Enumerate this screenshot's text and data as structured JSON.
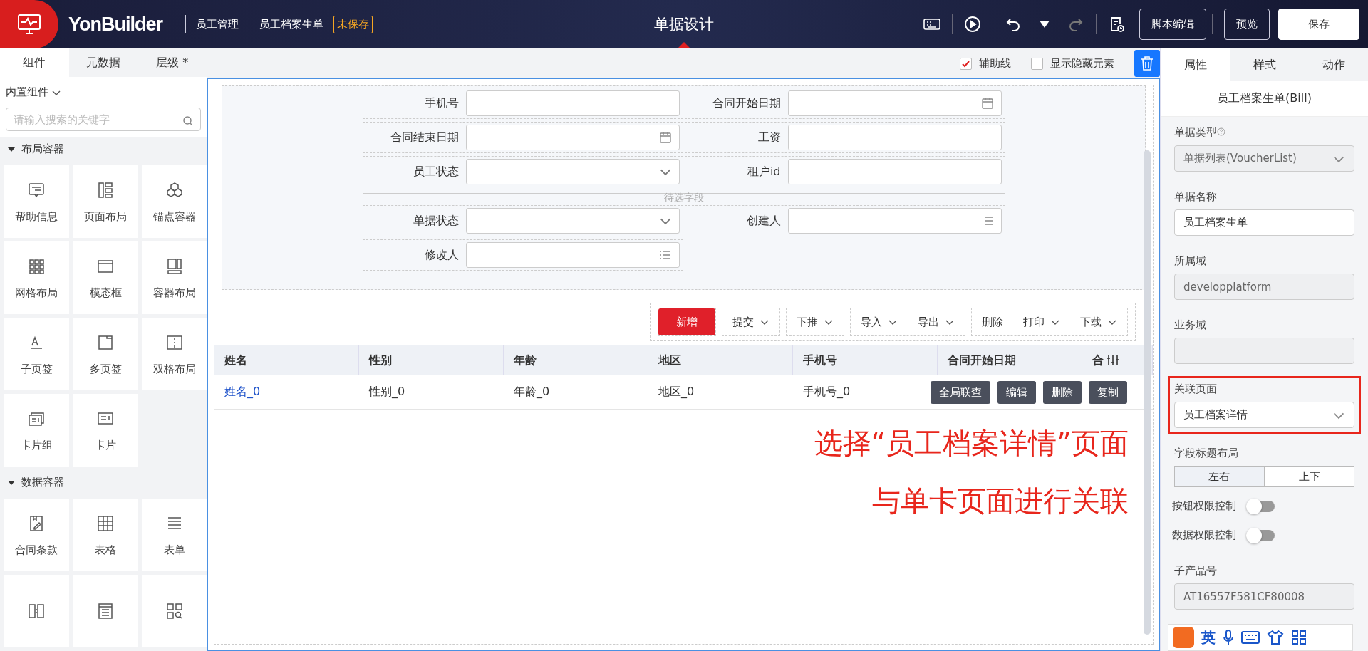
{
  "header": {
    "logo": "YonBuilder",
    "breadcrumbs": [
      "员工管理",
      "员工档案生单"
    ],
    "badge": "未保存",
    "title": "单据设计",
    "redo_disabled": true,
    "buttons": [
      {
        "label": "脚本编辑",
        "kind": "outline"
      },
      {
        "label": "预览",
        "kind": "outline"
      },
      {
        "label": "保存",
        "kind": "solid"
      }
    ]
  },
  "left_panel": {
    "tabs": [
      {
        "label": "组件",
        "selected": true
      },
      {
        "label": "元数据",
        "selected": false
      },
      {
        "label": "层级 *",
        "selected": false
      }
    ],
    "dropdown": "内置组件",
    "search": {
      "placeholder": "请输入搜索的关键字"
    },
    "groups": [
      {
        "title": "布局容器",
        "expanded": true,
        "items": [
          "帮助信息",
          "页面布局",
          "锚点容器",
          "网格布局",
          "模态框",
          "容器布局",
          "子页签",
          "多页签",
          "双格布局",
          "卡片组",
          "卡片"
        ]
      },
      {
        "title": "数据容器",
        "expanded": true,
        "items": [
          "合同条款",
          "表格",
          "表单"
        ]
      }
    ]
  },
  "canvas": {
    "toolbar": [
      {
        "label": "辅助线",
        "checked": true
      },
      {
        "label": "显示隐藏元素",
        "checked": false
      }
    ],
    "form_rows": [
      {
        "kind": "fields",
        "fields": [
          {
            "label": "手机号",
            "kind": "text"
          },
          {
            "label": "合同开始日期",
            "kind": "date"
          }
        ]
      },
      {
        "kind": "fields",
        "fields": [
          {
            "label": "合同结束日期",
            "kind": "date"
          },
          {
            "label": "工资",
            "kind": "text"
          }
        ]
      },
      {
        "kind": "fields",
        "fields": [
          {
            "label": "员工状态",
            "kind": "select"
          },
          {
            "label": "租户id",
            "kind": "text"
          }
        ]
      },
      {
        "kind": "divider",
        "label": "待选字段"
      },
      {
        "kind": "fields",
        "fields": [
          {
            "label": "单据状态",
            "kind": "select"
          },
          {
            "label": "创建人",
            "kind": "ref"
          }
        ]
      },
      {
        "kind": "fields",
        "fields": [
          {
            "label": "修改人",
            "kind": "ref"
          }
        ]
      }
    ],
    "button_groups": [
      [
        {
          "label": "新增",
          "kind": "primary",
          "caret": false
        }
      ],
      [
        {
          "label": "提交",
          "kind": "plain",
          "caret": true
        }
      ],
      [
        {
          "label": "下推",
          "kind": "plain",
          "caret": true
        }
      ],
      [
        {
          "label": "导入",
          "kind": "plain",
          "caret": true
        },
        {
          "label": "导出",
          "kind": "plain",
          "caret": true
        }
      ],
      [
        {
          "label": "删除",
          "kind": "plain",
          "caret": false
        },
        {
          "label": "打印",
          "kind": "plain",
          "caret": true
        },
        {
          "label": "下载",
          "kind": "plain",
          "caret": true
        }
      ]
    ],
    "table": {
      "columns": [
        "姓名",
        "性别",
        "年龄",
        "地区",
        "手机号",
        "合同开始日期",
        "合"
      ],
      "rows": [
        {
          "cells": [
            "姓名_0",
            "性别_0",
            "年龄_0",
            "地区_0",
            "手机号_0",
            "",
            ""
          ],
          "actions": [
            "全局联查",
            "编辑",
            "删除",
            "复制"
          ]
        }
      ]
    },
    "annotation": [
      "选择“员工档案详情”页面",
      "与单卡页面进行关联"
    ]
  },
  "right_panel": {
    "tabs": [
      {
        "label": "属性",
        "selected": true
      },
      {
        "label": "样式",
        "selected": false
      },
      {
        "label": "动作",
        "selected": false
      }
    ],
    "title": "员工档案生单(Bill)",
    "props": [
      {
        "kind": "select",
        "label": "单据类型",
        "help": true,
        "value": "单据列表(VoucherList)",
        "disabled": true,
        "highlighted": false
      },
      {
        "kind": "input",
        "label": "单据名称",
        "value": "员工档案生单",
        "disabled": false,
        "highlighted": false
      },
      {
        "kind": "input",
        "label": "所属域",
        "value": "developplatform",
        "disabled": true,
        "highlighted": false
      },
      {
        "kind": "input",
        "label": "业务域",
        "disabled": true,
        "highlighted": false
      },
      {
        "kind": "select",
        "label": "关联页面",
        "value": "员工档案详情",
        "disabled": false,
        "highlighted": true
      },
      {
        "kind": "segmented",
        "label": "字段标题布局",
        "options": [
          {
            "label": "左右",
            "selected": true
          },
          {
            "label": "上下",
            "selected": false
          }
        ]
      },
      {
        "kind": "switch",
        "label": "按钮权限控制",
        "on": false
      },
      {
        "kind": "switch",
        "label": "数据权限控制",
        "on": false
      },
      {
        "kind": "input",
        "label": "子产品号",
        "value": "AT16557F581CF80008",
        "disabled": true,
        "highlighted": false
      }
    ]
  },
  "ime_bar": {
    "label": "英"
  }
}
